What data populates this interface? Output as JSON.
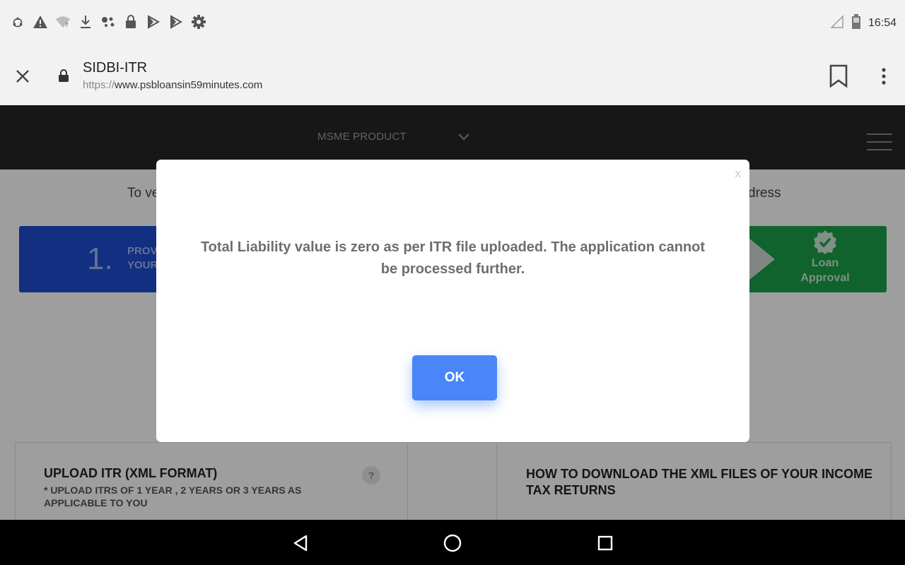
{
  "status_bar": {
    "time": "16:54",
    "icons": [
      "sync-icon",
      "warning-icon",
      "wifi-unknown-icon",
      "download-icon",
      "assistant-icon",
      "lock-icon",
      "play-store-icon",
      "play-store-icon",
      "settings-icon"
    ]
  },
  "browser": {
    "title": "SIDBI-ITR",
    "url_scheme": "https://",
    "url_host": "www.psbloansin59minutes.com"
  },
  "site": {
    "product_menu": "MSME PRODUCT",
    "verify_text_left": "To ve",
    "verify_text_right": "dress",
    "step1_number": "1.",
    "step1_line1": "PROV",
    "step1_line2": "YOUR",
    "final_step_line1": "Loan",
    "final_step_line2": "Approval",
    "upload_title": "UPLOAD ITR (XML FORMAT)",
    "upload_sub": "* UPLOAD ITRS OF 1 YEAR , 2 YEARS OR 3 YEARS AS APPLICABLE TO YOU",
    "help_label": "?",
    "howto_title": "HOW TO DOWNLOAD THE XML FILES OF YOUR INCOME TAX RETURNS"
  },
  "modal": {
    "close_label": "x",
    "message": "Total Liability value is zero as per ITR file uploaded. The application cannot be processed further.",
    "ok_label": "OK"
  },
  "colors": {
    "ok_button": "#4a86f7",
    "step1": "#1d4cd1",
    "final_step": "#1aa14a",
    "site_header": "#262626"
  }
}
